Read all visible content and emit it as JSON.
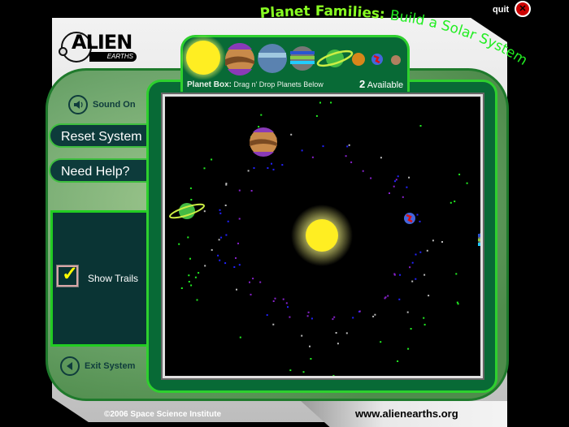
{
  "header": {
    "title_part1": "Planet Families:",
    "title_part2": "Build a Solar System",
    "quit_label": "quit",
    "quit_icon": "close-icon"
  },
  "logo": {
    "word": "ALIEN",
    "sub": "EARTHS"
  },
  "side_panel": {
    "sound_label": "Sound On",
    "reset_label": "Reset System",
    "help_label": "Need Help?",
    "show_trails_label": "Show Trails",
    "show_trails_checked": true,
    "exit_label": "Exit System"
  },
  "planet_box": {
    "label_bold": "Planet Box:",
    "label_rest": "Drag n' Drop Planets Below",
    "available_count": "2",
    "available_label": "Available",
    "items": [
      {
        "name": "sun",
        "color": "#ffee22"
      },
      {
        "name": "jupiter-like",
        "color": "#c88a4a",
        "accent": "#8a3ab8"
      },
      {
        "name": "neptune-like",
        "color": "#5a82b0",
        "accent": "#a0c8e0"
      },
      {
        "name": "striped-gas-giant",
        "color": "#2a55d0",
        "accent": "#88cc44"
      },
      {
        "name": "ringed-planet",
        "color": "#44bb44",
        "accent": "#ccee44"
      },
      {
        "name": "orange-rocky",
        "color": "#d8861a"
      },
      {
        "name": "red-blue-planet",
        "color": "#4466dd",
        "accent": "#dd1111"
      },
      {
        "name": "brown-rocky",
        "color": "#b08060"
      }
    ]
  },
  "simulation": {
    "placed_bodies": [
      {
        "name": "sun",
        "color": "#ffee22"
      },
      {
        "name": "jupiter-like",
        "color": "#c88a4a"
      },
      {
        "name": "ringed-planet",
        "color": "#44bb44"
      },
      {
        "name": "red-blue-planet",
        "color": "#4466dd"
      },
      {
        "name": "striped-gas-giant",
        "color": "#2a55d0"
      }
    ],
    "trail_colors": [
      "#22ee22",
      "#2222ff",
      "#8822cc",
      "#bbbbbb"
    ]
  },
  "footer": {
    "copyright": "©2006 Space Science Institute",
    "url": "www.alienearths.org"
  },
  "colors": {
    "accent_green": "#2ed02e",
    "frame_green": "#086a36",
    "title_green": "#33ff33"
  }
}
